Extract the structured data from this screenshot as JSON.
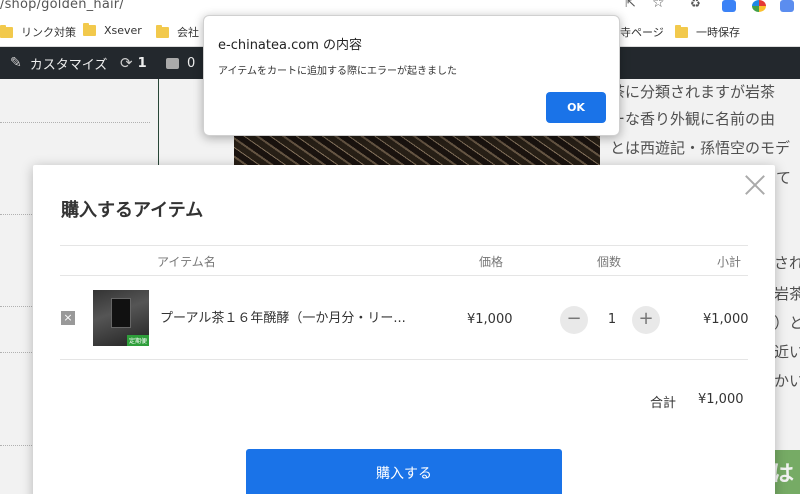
{
  "browser": {
    "url": "/shop/golden_hair/",
    "bookmarks": [
      "リンク対策",
      "Xsever",
      "会社",
      "寺ページ",
      "一時保存"
    ]
  },
  "adminbar": {
    "customize_label": "カスタマイズ",
    "updates_count": "1",
    "comments_count": "0"
  },
  "background_text": {
    "lines": [
      "茶に分類されますが岩茶",
      "ーな香り外観に名前の由",
      "とは西遊記・孫悟空のモデ",
      "て"
    ],
    "side_fragments": [
      "され",
      "岩茶",
      "）と",
      "近い",
      "かい"
    ],
    "banner_char": "は"
  },
  "alert": {
    "title": "e-chinatea.com の内容",
    "message": "アイテムをカートに追加する際にエラーが起きました",
    "ok_label": "OK"
  },
  "cart": {
    "title": "購入するアイテム",
    "columns": {
      "item": "アイテム名",
      "price": "価格",
      "quantity": "個数",
      "subtotal": "小計"
    },
    "items": [
      {
        "remove_symbol": "×",
        "name": "プーアル茶１６年醗酵（一か月分・リー...",
        "thumb_tag": "定期便",
        "price": "¥1,000",
        "quantity": "1",
        "subtotal": "¥1,000",
        "minus": "−",
        "plus": "+"
      }
    ],
    "total_label": "合計",
    "total_value": "¥1,000",
    "buy_label": "購入する"
  }
}
